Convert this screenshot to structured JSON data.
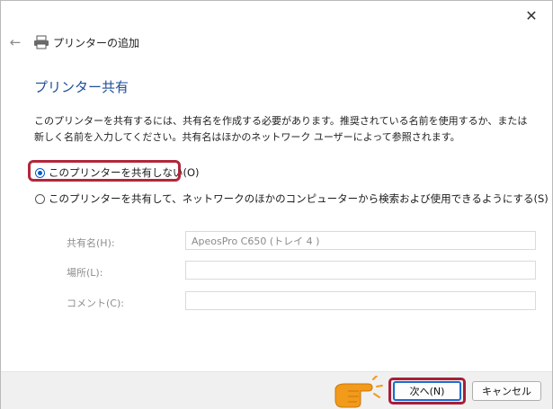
{
  "window": {
    "close_glyph": "✕"
  },
  "header": {
    "back_icon": "back-arrow-icon",
    "back_glyph": "←",
    "printer_icon": "printer-icon",
    "title": "プリンターの追加"
  },
  "page_title": "プリンター共有",
  "description": "このプリンターを共有するには、共有名を作成する必要があります。推奨されている名前を使用するか、または新しく名前を入力してください。共有名はほかのネットワーク ユーザーによって参照されます。",
  "options": {
    "no_share": {
      "label": "このプリンターを共有しない(O)",
      "checked": true
    },
    "share": {
      "label": "このプリンターを共有して、ネットワークのほかのコンピューターから検索および使用できるようにする(S)",
      "checked": false
    }
  },
  "fields": {
    "share_name": {
      "label": "共有名(H):",
      "value": "ApeosPro C650 (トレイ 4 )"
    },
    "location": {
      "label": "場所(L):",
      "value": ""
    },
    "comment": {
      "label": "コメント(C):",
      "value": ""
    }
  },
  "buttons": {
    "next": "次へ(N)",
    "cancel": "キャンセル"
  },
  "colors": {
    "accent": "#1e4e9a",
    "highlight": "#b3263a",
    "hand": "#f29a1a"
  }
}
